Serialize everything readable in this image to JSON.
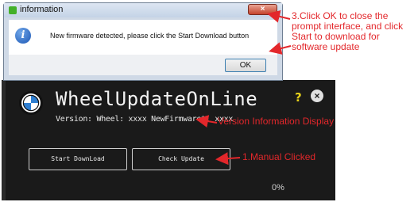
{
  "dialog": {
    "title": "information",
    "message": "New firmware detected, please click the Start Download button",
    "ok_label": "OK",
    "close_glyph": "×"
  },
  "app": {
    "title": "WheelUpdateOnLine",
    "version_line": "Version: Wheel: xxxx NewFirmwaret: xxxx",
    "help_glyph": "?",
    "close_glyph": "×",
    "buttons": {
      "start_download": "Start DownLoad",
      "check_update": "Check Update"
    },
    "progress": "0%"
  },
  "annotations": {
    "step3": "3.Click OK to close the prompt interface, and click Start to download for software update",
    "version_info": "Version Information Display",
    "step1": "1.Manual Clicked"
  },
  "colors": {
    "annotation": "#e3272b",
    "app_background": "#1a1a1a",
    "help_icon": "#e6d11a"
  },
  "icons": {
    "dialog_icon": "info-icon",
    "app_logo": "bmw-roundel-icon"
  }
}
